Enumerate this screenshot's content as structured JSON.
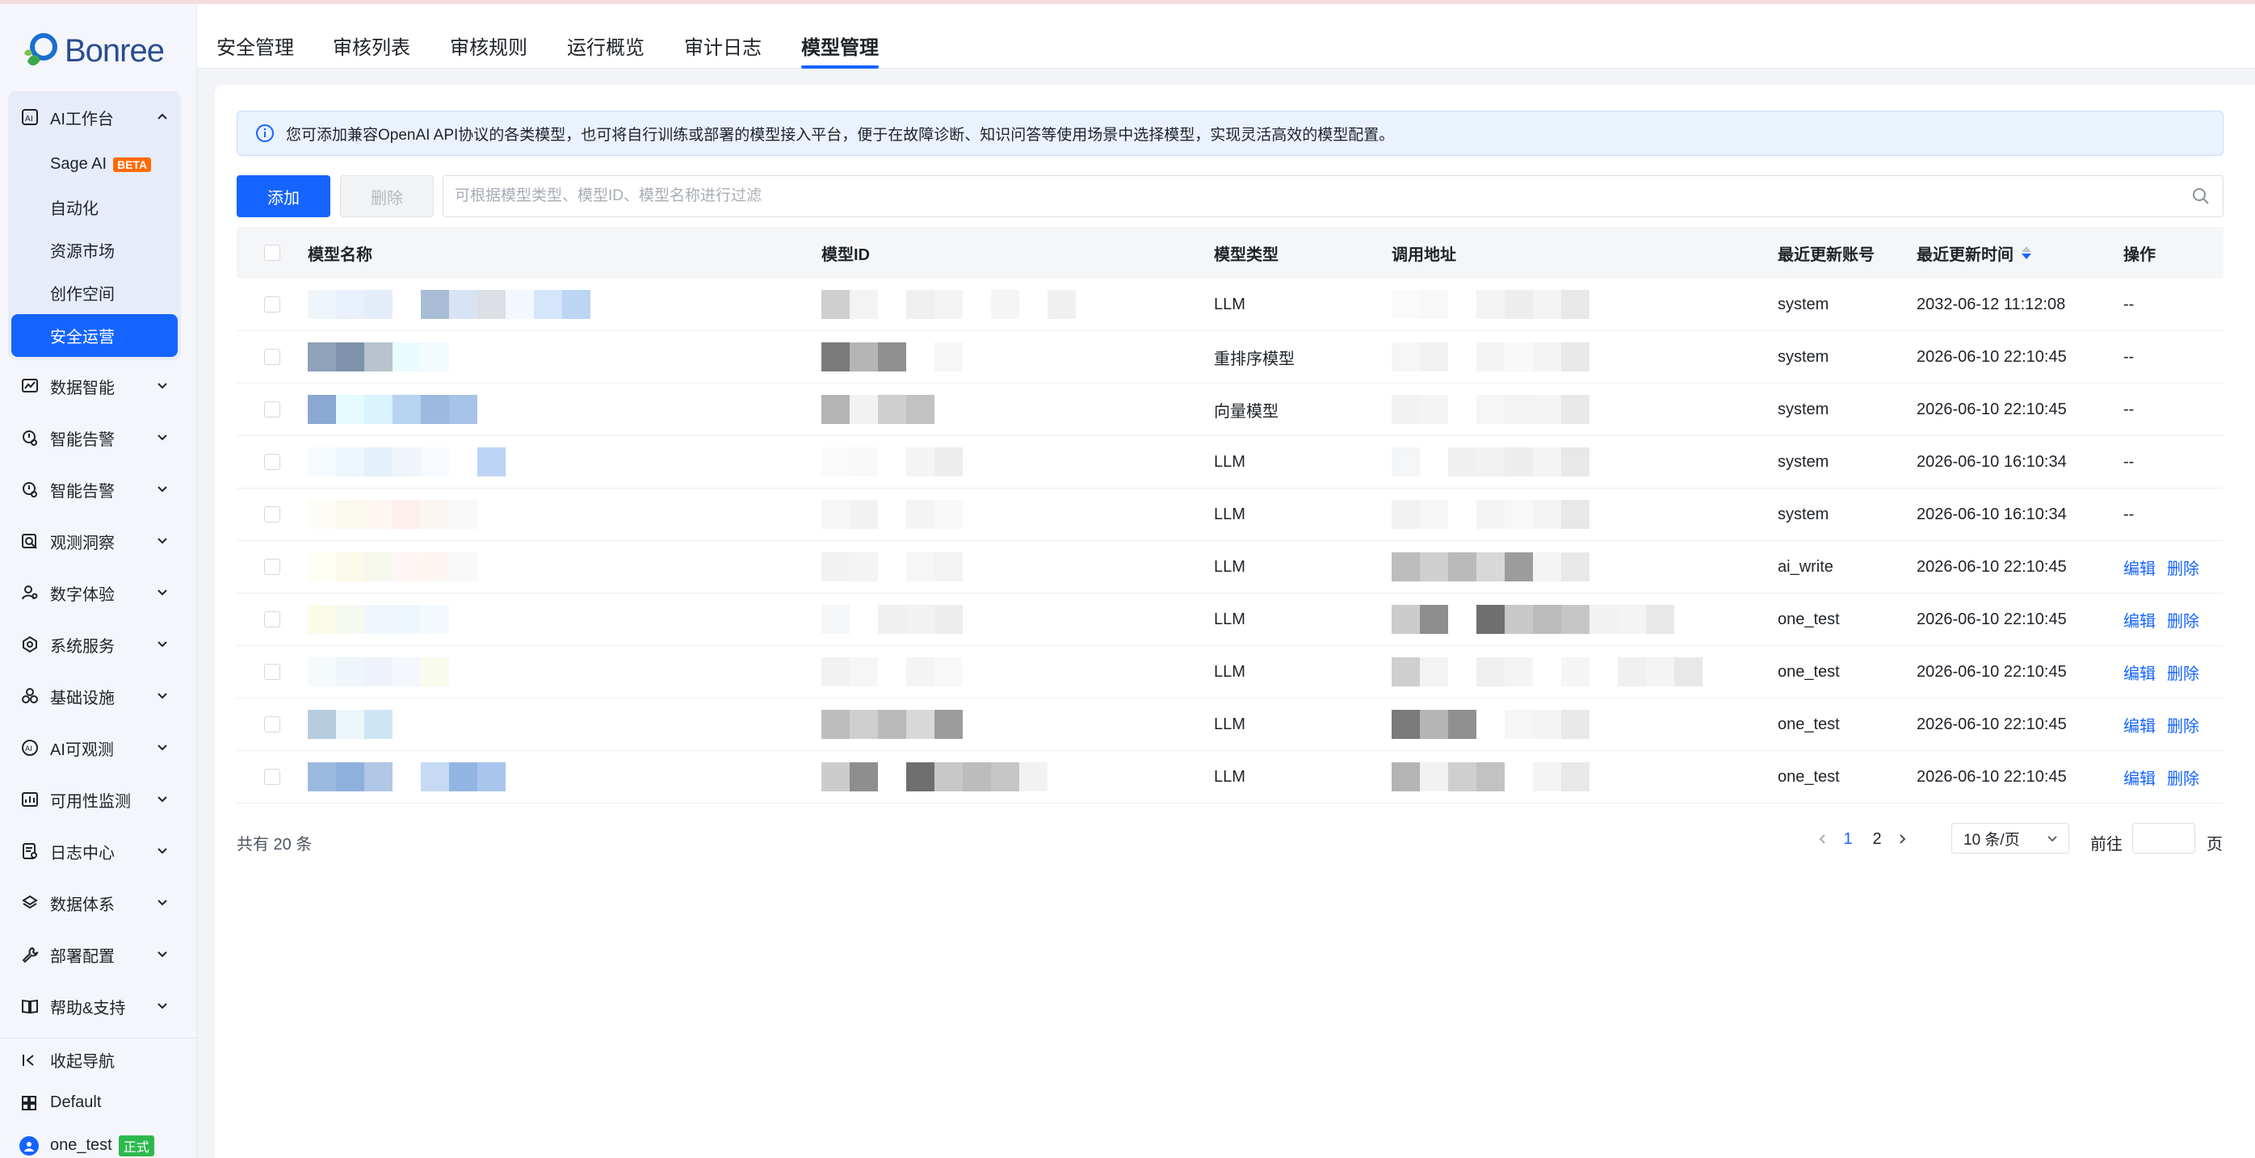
{
  "brand": {
    "logo_text": "Bonree"
  },
  "sidebar": {
    "group": {
      "label": "AI工作台",
      "items": [
        {
          "label": "Sage AI",
          "badge": "BETA"
        },
        {
          "label": "自动化"
        },
        {
          "label": "资源市场"
        },
        {
          "label": "创作空间"
        },
        {
          "label": "安全运营",
          "active": true
        }
      ]
    },
    "items": [
      {
        "label": "数据智能",
        "icon": "chart-icon"
      },
      {
        "label": "智能告警",
        "icon": "alert-icon"
      },
      {
        "label": "智能告警",
        "icon": "alert-icon"
      },
      {
        "label": "观测洞察",
        "icon": "search-doc-icon"
      },
      {
        "label": "数字体验",
        "icon": "user-icon"
      },
      {
        "label": "系统服务",
        "icon": "service-icon"
      },
      {
        "label": "基础设施",
        "icon": "infra-icon"
      },
      {
        "label": "AI可观测",
        "icon": "ai-observe-icon"
      },
      {
        "label": "可用性监测",
        "icon": "monitor-icon"
      },
      {
        "label": "日志中心",
        "icon": "log-icon"
      },
      {
        "label": "数据体系",
        "icon": "data-icon"
      },
      {
        "label": "部署配置",
        "icon": "wrench-icon"
      },
      {
        "label": "帮助&支持",
        "icon": "book-icon"
      }
    ],
    "bottom": {
      "collapse_label": "收起导航",
      "workspace_label": "Default",
      "user_name": "one_test",
      "user_badge": "正式"
    }
  },
  "tabs": [
    {
      "label": "安全管理"
    },
    {
      "label": "审核列表"
    },
    {
      "label": "审核规则"
    },
    {
      "label": "运行概览"
    },
    {
      "label": "审计日志"
    },
    {
      "label": "模型管理",
      "active": true
    }
  ],
  "alert": {
    "text": "您可添加兼容OpenAI API协议的各类模型，也可将自行训练或部署的模型接入平台，便于在故障诊断、知识问答等使用场景中选择模型，实现灵活高效的模型配置。"
  },
  "toolbar": {
    "add_label": "添加",
    "delete_label": "删除",
    "search_placeholder": "可根据模型类型、模型ID、模型名称进行过滤"
  },
  "table": {
    "headers": {
      "name": "模型名称",
      "id": "模型ID",
      "type": "模型类型",
      "url": "调用地址",
      "user": "最近更新账号",
      "time": "最近更新时间",
      "op": "操作"
    },
    "rows": [
      {
        "type": "LLM",
        "user": "system",
        "time": "2032-06-12 11:12:08",
        "op": "--"
      },
      {
        "type": "重排序模型",
        "user": "system",
        "time": "2026-06-10 22:10:45",
        "op": "--"
      },
      {
        "type": "向量模型",
        "user": "system",
        "time": "2026-06-10 22:10:45",
        "op": "--"
      },
      {
        "type": "LLM",
        "user": "system",
        "time": "2026-06-10 16:10:34",
        "op": "--"
      },
      {
        "type": "LLM",
        "user": "system",
        "time": "2026-06-10 16:10:34",
        "op": "--"
      },
      {
        "type": "LLM",
        "user": "ai_write",
        "time": "2026-06-10 22:10:45",
        "edit": "编辑",
        "delete": "删除"
      },
      {
        "type": "LLM",
        "user": "one_test",
        "time": "2026-06-10 22:10:45",
        "edit": "编辑",
        "delete": "删除"
      },
      {
        "type": "LLM",
        "user": "one_test",
        "time": "2026-06-10 22:10:45",
        "edit": "编辑",
        "delete": "删除"
      },
      {
        "type": "LLM",
        "user": "one_test",
        "time": "2026-06-10 22:10:45",
        "edit": "编辑",
        "delete": "删除"
      },
      {
        "type": "LLM",
        "user": "one_test",
        "time": "2026-06-10 22:10:45",
        "edit": "编辑",
        "delete": "删除"
      }
    ]
  },
  "pagination": {
    "total_text": "共有 20 条",
    "pages": [
      "1",
      "2"
    ],
    "current": "1",
    "page_size": "10 条/页",
    "goto_label": "前往",
    "page_suffix": "页"
  },
  "colors": {
    "primary": "#1664ff",
    "beta": "#ff6a00",
    "badge_green": "#2db84d"
  }
}
